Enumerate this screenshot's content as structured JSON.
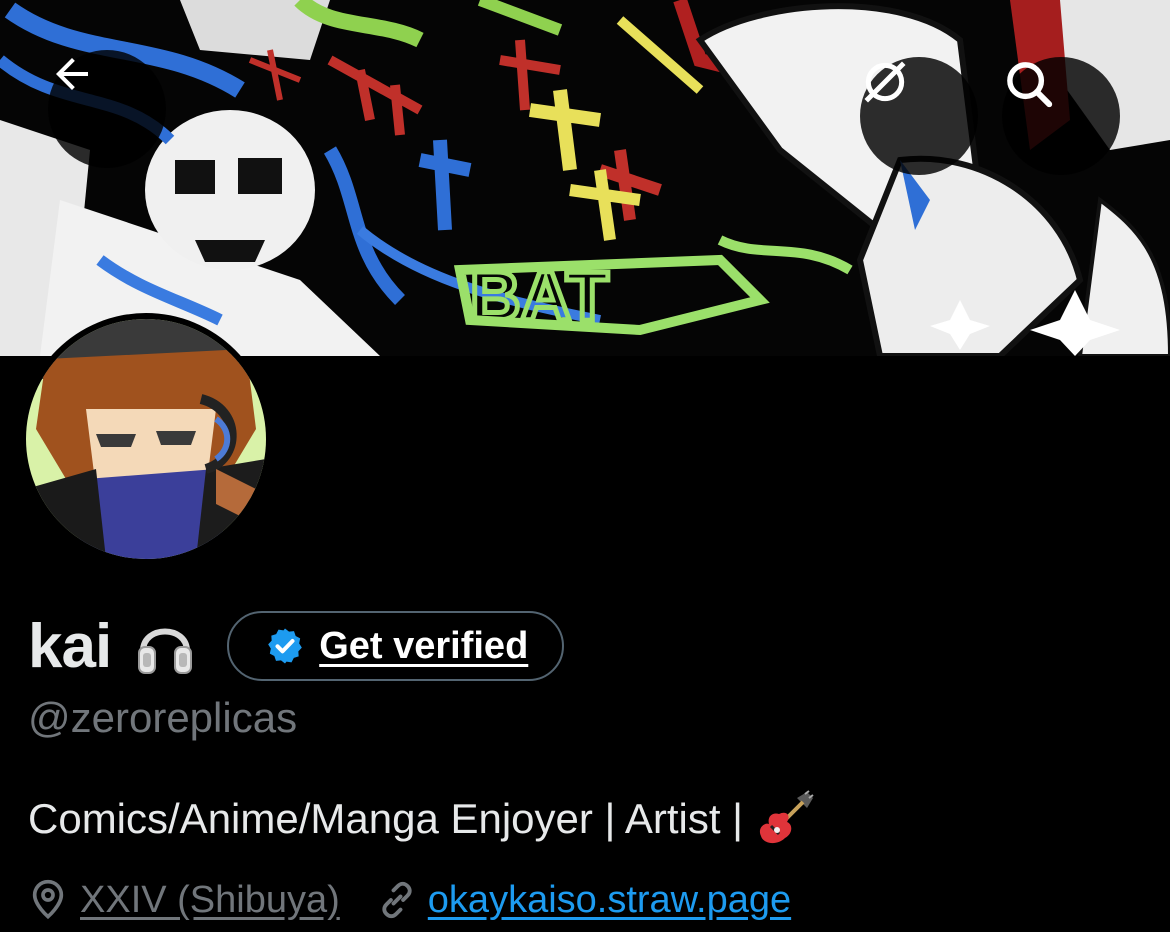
{
  "profile": {
    "display_name": "kai",
    "handle": "@zeroreplicas",
    "bio": "Comics/Anime/Manga Enjoyer | Artist |",
    "location": "XXIV (Shibuya)",
    "website": "okaykaiso.straw.page"
  },
  "actions": {
    "get_verified_label": "Get verified"
  },
  "banner": {
    "art_text": "BAT"
  },
  "icons": {
    "back": "back-arrow-icon",
    "grok": "grok-icon",
    "search": "search-icon",
    "verified": "verified-badge-icon",
    "headphones": "headphones-emoji",
    "guitar": "guitar-emoji",
    "location": "location-pin-icon",
    "link": "link-icon"
  },
  "colors": {
    "background": "#000000",
    "primary_text": "#e7e9ea",
    "secondary_text": "#71767b",
    "link": "#1d9bf0",
    "verified_badge": "#1d9bf0",
    "button_border": "#536471"
  }
}
